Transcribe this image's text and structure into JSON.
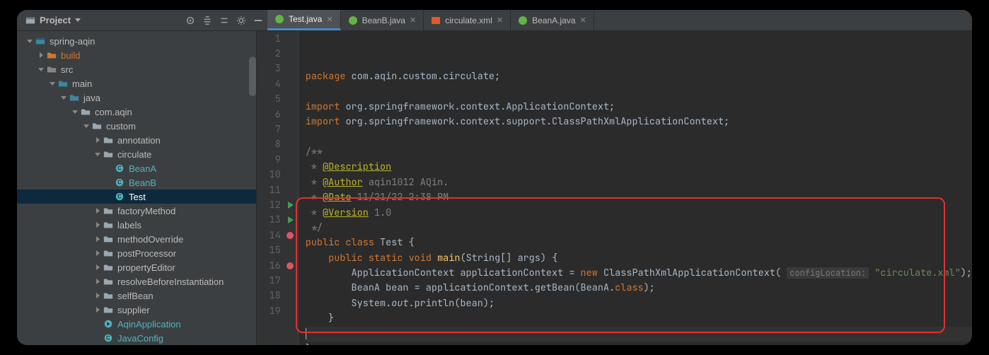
{
  "toolbar": {
    "project_label": "Project"
  },
  "tabs": [
    {
      "label": "Test.java",
      "kind": "java",
      "active": true
    },
    {
      "label": "BeanB.java",
      "kind": "java",
      "active": false
    },
    {
      "label": "circulate.xml",
      "kind": "xml",
      "active": false
    },
    {
      "label": "BeanA.java",
      "kind": "java",
      "active": false
    }
  ],
  "tree": [
    {
      "depth": 0,
      "arrow": "down",
      "icon": "module",
      "label": "spring-aqin",
      "cls": ""
    },
    {
      "depth": 1,
      "arrow": "right",
      "icon": "folder-orange",
      "label": "build",
      "cls": "orange"
    },
    {
      "depth": 1,
      "arrow": "down",
      "icon": "folder",
      "label": "src",
      "cls": ""
    },
    {
      "depth": 2,
      "arrow": "down",
      "icon": "source-root",
      "label": "main",
      "cls": ""
    },
    {
      "depth": 3,
      "arrow": "down",
      "icon": "source-root",
      "label": "java",
      "cls": ""
    },
    {
      "depth": 4,
      "arrow": "down",
      "icon": "package",
      "label": "com.aqin",
      "cls": ""
    },
    {
      "depth": 5,
      "arrow": "down",
      "icon": "package",
      "label": "custom",
      "cls": ""
    },
    {
      "depth": 6,
      "arrow": "right",
      "icon": "package",
      "label": "annotation",
      "cls": ""
    },
    {
      "depth": 6,
      "arrow": "down",
      "icon": "package",
      "label": "circulate",
      "cls": ""
    },
    {
      "depth": 7,
      "arrow": "blank",
      "icon": "class",
      "label": "BeanA",
      "cls": "teal"
    },
    {
      "depth": 7,
      "arrow": "blank",
      "icon": "class",
      "label": "BeanB",
      "cls": "teal"
    },
    {
      "depth": 7,
      "arrow": "blank",
      "icon": "class",
      "label": "Test",
      "cls": "teal",
      "selected": true
    },
    {
      "depth": 6,
      "arrow": "right",
      "icon": "package",
      "label": "factoryMethod",
      "cls": ""
    },
    {
      "depth": 6,
      "arrow": "right",
      "icon": "package",
      "label": "labels",
      "cls": ""
    },
    {
      "depth": 6,
      "arrow": "right",
      "icon": "package",
      "label": "methodOverride",
      "cls": ""
    },
    {
      "depth": 6,
      "arrow": "right",
      "icon": "package",
      "label": "postProcessor",
      "cls": ""
    },
    {
      "depth": 6,
      "arrow": "right",
      "icon": "package",
      "label": "propertyEditor",
      "cls": ""
    },
    {
      "depth": 6,
      "arrow": "right",
      "icon": "package",
      "label": "resolveBeforeInstantiation",
      "cls": ""
    },
    {
      "depth": 6,
      "arrow": "right",
      "icon": "package",
      "label": "selfBean",
      "cls": ""
    },
    {
      "depth": 6,
      "arrow": "right",
      "icon": "package",
      "label": "supplier",
      "cls": ""
    },
    {
      "depth": 6,
      "arrow": "blank",
      "icon": "class-run",
      "label": "AqinApplication",
      "cls": "teal"
    },
    {
      "depth": 6,
      "arrow": "blank",
      "icon": "class",
      "label": "JavaConfig",
      "cls": "teal"
    }
  ],
  "code": {
    "package": "package com.aqin.custom.circulate;",
    "imports": [
      "import org.springframework.context.ApplicationContext;",
      "import org.springframework.context.support.ClassPathXmlApplicationContext;"
    ],
    "javadoc": {
      "desc_tag": "@Description",
      "author_tag": "@Author",
      "author_val": "aqin1012 AQin.",
      "date_tag": "@Date",
      "date_val": "11/21/22 2:38 PM",
      "version_tag": "@Version",
      "version_val": "1.0"
    },
    "class_sig": "public class Test {",
    "main_sig": "public static void main(String[] args) {",
    "line14_hint": "configLocation:",
    "line14_str": "\"circulate.xml\"",
    "line15": "BeanA bean = applicationContext.getBean(BeanA.class);",
    "line16": "System.out.println(bean);"
  },
  "gutter_lines": [
    1,
    2,
    3,
    4,
    5,
    6,
    7,
    8,
    9,
    10,
    11,
    12,
    13,
    14,
    15,
    16,
    17,
    18,
    19
  ]
}
